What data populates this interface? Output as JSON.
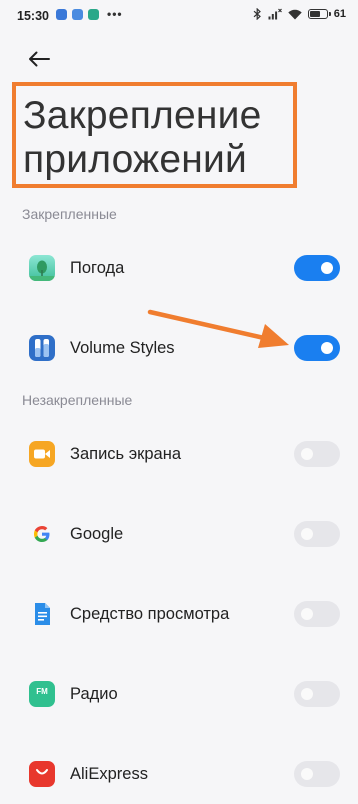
{
  "status_bar": {
    "time": "15:30",
    "battery": "61",
    "battery_level": 0.61,
    "more_glyph": "•••"
  },
  "header": {
    "back_icon": "back-arrow-icon",
    "title": "Закрепление приложений"
  },
  "sections": {
    "pinned": {
      "title": "Закрепленные",
      "items": [
        {
          "name": "Погода",
          "icon": "weather-app-icon",
          "pinned": true
        },
        {
          "name": "Volume Styles",
          "icon": "volume-styles-app-icon",
          "pinned": true
        }
      ]
    },
    "unpinned": {
      "title": "Незакрепленные",
      "items": [
        {
          "name": "Запись экрана",
          "icon": "screen-recorder-icon",
          "pinned": false
        },
        {
          "name": "Google",
          "icon": "google-icon",
          "pinned": false
        },
        {
          "name": "Средство просмотра",
          "icon": "document-viewer-icon",
          "pinned": false
        },
        {
          "name": "Радио",
          "icon": "fm-radio-icon",
          "icon_text": "FM",
          "pinned": false
        },
        {
          "name": "AliExpress",
          "icon": "aliexpress-icon",
          "pinned": false
        }
      ]
    }
  },
  "colors": {
    "accent": "#1a7ff0",
    "annotation": "#f07d2f",
    "toggle_off": "#e6e6ea",
    "background": "#f6f6f8"
  }
}
